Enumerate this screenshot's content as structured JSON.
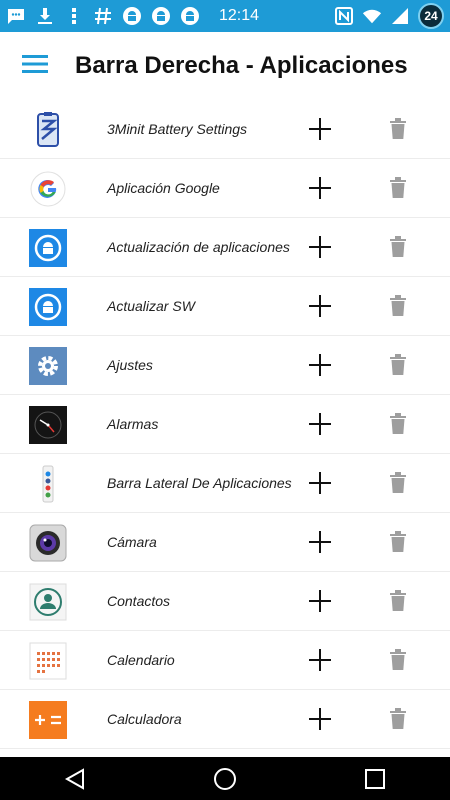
{
  "status_bar": {
    "time": "12:14",
    "notification_badge": "24",
    "icons": [
      "chat-icon",
      "download-icon",
      "more-vert-icon",
      "hash-icon",
      "android-icon",
      "android-icon",
      "android-icon",
      "nfc-icon",
      "wifi-icon",
      "signal-icon"
    ],
    "background": "#1e9bd6"
  },
  "header": {
    "title": "Barra Derecha - Aplicaciones",
    "menu_icon": "hamburger-menu-icon",
    "accent": "#1e9bd6"
  },
  "apps": [
    {
      "label": "3Minit Battery Settings",
      "icon": "battery-settings-icon"
    },
    {
      "label": "Aplicación Google",
      "icon": "google-icon"
    },
    {
      "label": "Actualización de aplicaciones",
      "icon": "android-update-icon"
    },
    {
      "label": "Actualizar SW",
      "icon": "android-update-icon"
    },
    {
      "label": "Ajustes",
      "icon": "settings-gear-icon"
    },
    {
      "label": "Alarmas",
      "icon": "clock-icon"
    },
    {
      "label": "Barra Lateral De Aplicaciones",
      "icon": "sidebar-apps-icon"
    },
    {
      "label": "Cámara",
      "icon": "camera-icon"
    },
    {
      "label": "Contactos",
      "icon": "contacts-icon"
    },
    {
      "label": "Calendario",
      "icon": "calendar-icon"
    },
    {
      "label": "Calculadora",
      "icon": "calculator-icon"
    }
  ],
  "row_actions": {
    "add_icon": "plus-icon",
    "delete_icon": "trash-icon"
  },
  "nav_bar": {
    "buttons": [
      "back-icon",
      "home-icon",
      "recents-icon"
    ]
  }
}
